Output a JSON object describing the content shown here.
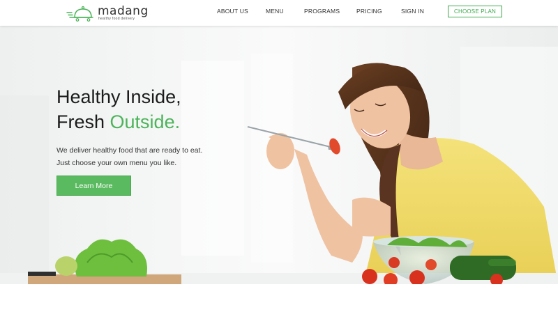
{
  "brand": {
    "name": "madang",
    "tagline": "healthy food delivery",
    "accent_color": "#4cb45a"
  },
  "nav": {
    "items": [
      {
        "label": "ABOUT US"
      },
      {
        "label": "MENU"
      },
      {
        "label": "PROGRAMS"
      },
      {
        "label": "PRICING"
      },
      {
        "label": "SIGN IN"
      }
    ],
    "cta_label": "CHOOSE PLAN"
  },
  "hero": {
    "headline_line1": "Healthy Inside,",
    "headline_line2_prefix": "Fresh ",
    "headline_line2_accent": "Outside.",
    "subtext_line1": "We deliver healthy food that are ready to eat.",
    "subtext_line2": "Just choose your own menu you like.",
    "button_label": "Learn More"
  }
}
